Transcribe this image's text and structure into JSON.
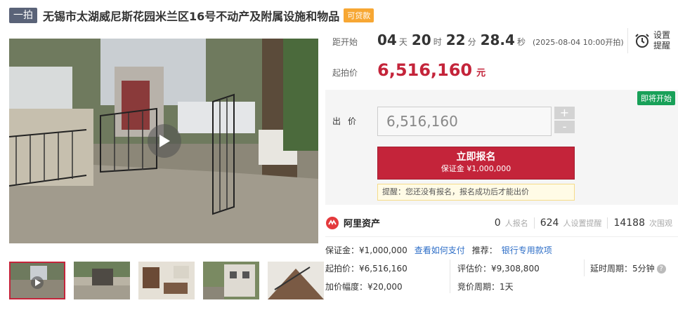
{
  "title": {
    "tag": "一拍",
    "text": "无锡市太湖威尼斯花园米兰区16号不动产及附属设施和物品",
    "loan_badge": "可贷款"
  },
  "countdown": {
    "label": "距开始",
    "days": "04",
    "days_unit": "天",
    "hours": "20",
    "hours_unit": "时",
    "minutes": "22",
    "minutes_unit": "分",
    "seconds": "28.4",
    "seconds_unit": "秒",
    "start_note": "(2025-08-04 10:00开拍)"
  },
  "reminder": {
    "line1": "设置",
    "line2": "提醒",
    "icon": "alarm-clock-icon"
  },
  "start_price": {
    "label": "起拍价",
    "value": "6,516,160",
    "unit": "元"
  },
  "bid": {
    "status_badge": "即将开始",
    "label": "出价",
    "input_value": "6,516,160",
    "plus": "+",
    "minus": "-",
    "signup_label": "立即报名",
    "signup_sub": "保证金 ¥1,000,000",
    "tip": "提醒：您还没有报名，报名成功后才能出价"
  },
  "platform": {
    "name": "阿里资产",
    "logo_color": "#e4393c"
  },
  "stats": [
    {
      "num": "0",
      "label": "人报名"
    },
    {
      "num": "624",
      "label": "人设置提醒"
    },
    {
      "num": "14188",
      "label": "次围观"
    }
  ],
  "deposit": {
    "text": "保证金：¥1,000,000",
    "link": "查看如何支付",
    "recommend_label": "推荐：",
    "recommend_link": "银行专用款项"
  },
  "details": {
    "start_price": "起拍价：¥6,516,160",
    "increment": "加价幅度：¥20,000",
    "appraisal": "评估价：¥9,308,800",
    "cycle": "竞价周期：1天",
    "delay": "延时周期：5分钟",
    "help": "?"
  },
  "colors": {
    "accent": "#c4243a",
    "link": "#2d6ec7",
    "badge_green": "#18a058",
    "badge_orange": "#f7a733"
  }
}
